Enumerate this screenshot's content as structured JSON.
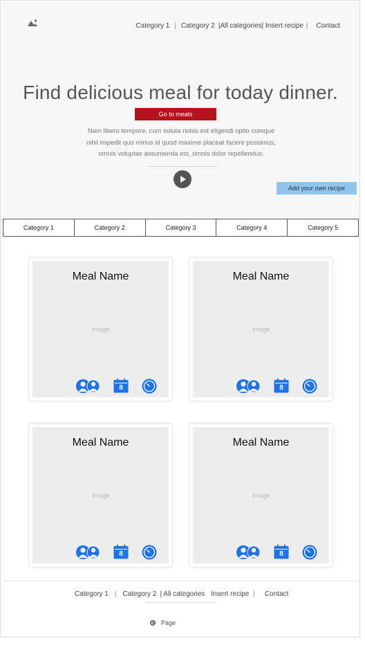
{
  "header": {
    "nav": {
      "category1": "Category 1",
      "sep1": "|",
      "category2": "Category 2",
      "all_categories": "|All categories",
      "insert_recipe": "| Insert recipe",
      "sep2": "|",
      "contact": "Contact"
    }
  },
  "hero": {
    "title": "Find delicious meal for today dinner.",
    "cta_label": "Go to meals",
    "text_line1": "Nam libero tempore, cum soluta nobis est eligendi optio cumque",
    "text_line2": "nihil impedit quo minus id quod maxime placeat facere possimus,",
    "text_line3": "omnis voluptas assumenda est, omnis dolor repellendus.",
    "add_recipe_label": "Add your own recipe"
  },
  "categories": [
    "Category 1",
    "Category 2",
    "Category 3",
    "Category 4",
    "Category 5"
  ],
  "meals": [
    {
      "name": "Meal Name",
      "image_label": "Image",
      "calendar_day": "8"
    },
    {
      "name": "Meal Name",
      "image_label": "Image",
      "calendar_day": "8"
    },
    {
      "name": "Meal Name",
      "image_label": "Image",
      "calendar_day": "8"
    },
    {
      "name": "Meal Name",
      "image_label": "Image",
      "calendar_day": "8"
    }
  ],
  "footer": {
    "nav": {
      "category1": "Category 1",
      "sep1": "|",
      "category2": "Category 2",
      "all_categories": "| All categories",
      "insert_recipe": "Insert recipe",
      "sep2": "|",
      "contact": "Contact"
    },
    "page_label": "Page"
  },
  "colors": {
    "accent_red": "#b3131b",
    "accent_blue_button": "#90c5ee",
    "icon_blue": "#1e73e8"
  },
  "icons": [
    "logo-icon",
    "play-icon",
    "people-icon",
    "calendar-icon",
    "clock-icon",
    "copyright-icon"
  ]
}
